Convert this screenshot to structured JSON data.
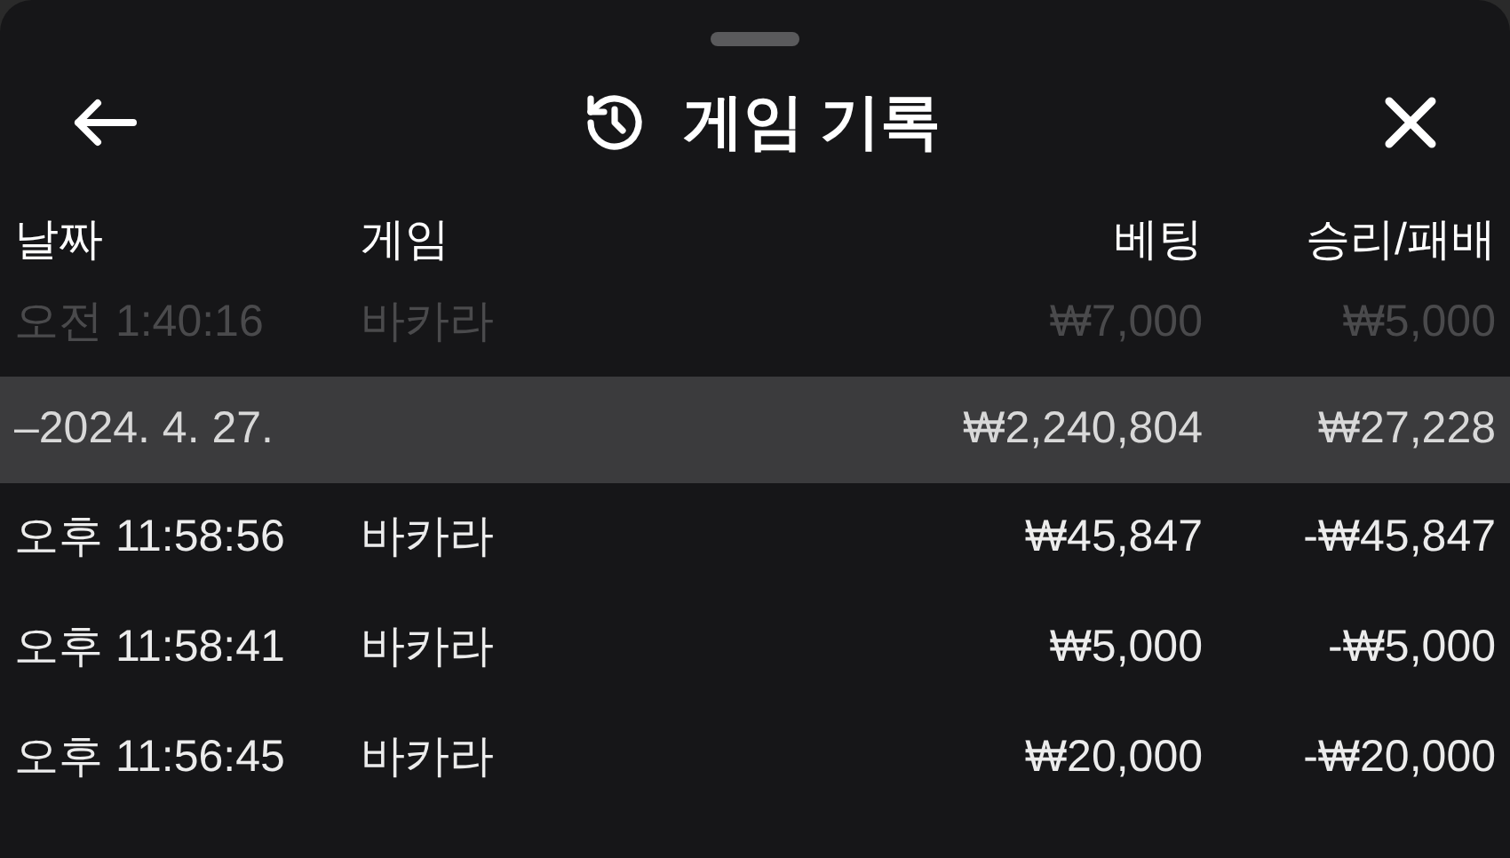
{
  "header": {
    "title": "게임 기록"
  },
  "columns": [
    "날짜",
    "게임",
    "베팅",
    "승리/패배"
  ],
  "rows": [
    {
      "kind": "faded",
      "date": "오전 1:40:16",
      "game": "바카라",
      "bet": "₩7,000",
      "result": "₩5,000"
    },
    {
      "kind": "group",
      "date": "–2024. 4. 27.",
      "bet": "₩2,240,804",
      "result": "₩27,228"
    },
    {
      "kind": "record",
      "date": "오후 11:58:56",
      "game": "바카라",
      "bet": "₩45,847",
      "result": "-₩45,847"
    },
    {
      "kind": "record",
      "date": "오후 11:58:41",
      "game": "바카라",
      "bet": "₩5,000",
      "result": "-₩5,000"
    },
    {
      "kind": "record",
      "date": "오후 11:56:45",
      "game": "바카라",
      "bet": "₩20,000",
      "result": "-₩20,000"
    }
  ]
}
